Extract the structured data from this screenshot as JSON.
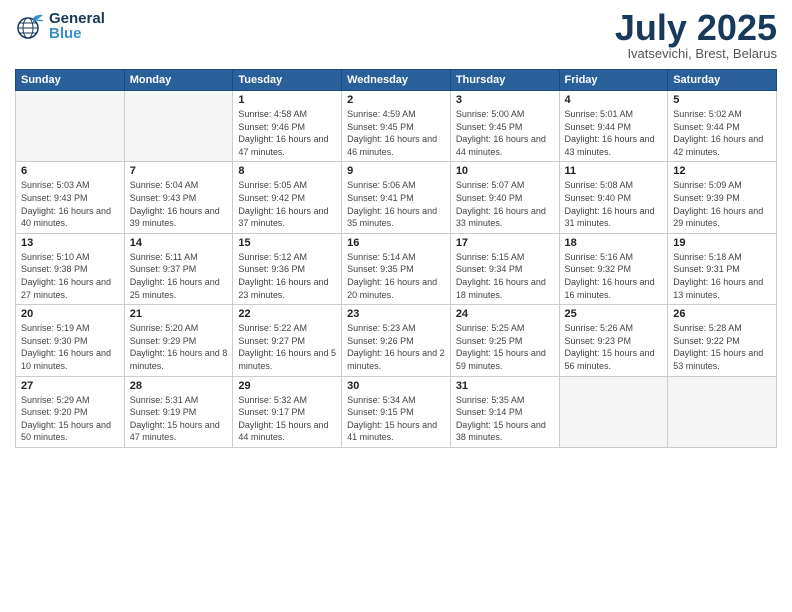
{
  "header": {
    "logo_general": "General",
    "logo_blue": "Blue",
    "month_title": "July 2025",
    "subtitle": "Ivatsevichi, Brest, Belarus"
  },
  "calendar": {
    "days_of_week": [
      "Sunday",
      "Monday",
      "Tuesday",
      "Wednesday",
      "Thursday",
      "Friday",
      "Saturday"
    ],
    "weeks": [
      [
        {
          "day": "",
          "sunrise": "",
          "sunset": "",
          "daylight": "",
          "empty": true
        },
        {
          "day": "",
          "sunrise": "",
          "sunset": "",
          "daylight": "",
          "empty": true
        },
        {
          "day": "1",
          "sunrise": "Sunrise: 4:58 AM",
          "sunset": "Sunset: 9:46 PM",
          "daylight": "Daylight: 16 hours and 47 minutes.",
          "empty": false
        },
        {
          "day": "2",
          "sunrise": "Sunrise: 4:59 AM",
          "sunset": "Sunset: 9:45 PM",
          "daylight": "Daylight: 16 hours and 46 minutes.",
          "empty": false
        },
        {
          "day": "3",
          "sunrise": "Sunrise: 5:00 AM",
          "sunset": "Sunset: 9:45 PM",
          "daylight": "Daylight: 16 hours and 44 minutes.",
          "empty": false
        },
        {
          "day": "4",
          "sunrise": "Sunrise: 5:01 AM",
          "sunset": "Sunset: 9:44 PM",
          "daylight": "Daylight: 16 hours and 43 minutes.",
          "empty": false
        },
        {
          "day": "5",
          "sunrise": "Sunrise: 5:02 AM",
          "sunset": "Sunset: 9:44 PM",
          "daylight": "Daylight: 16 hours and 42 minutes.",
          "empty": false
        }
      ],
      [
        {
          "day": "6",
          "sunrise": "Sunrise: 5:03 AM",
          "sunset": "Sunset: 9:43 PM",
          "daylight": "Daylight: 16 hours and 40 minutes.",
          "empty": false
        },
        {
          "day": "7",
          "sunrise": "Sunrise: 5:04 AM",
          "sunset": "Sunset: 9:43 PM",
          "daylight": "Daylight: 16 hours and 39 minutes.",
          "empty": false
        },
        {
          "day": "8",
          "sunrise": "Sunrise: 5:05 AM",
          "sunset": "Sunset: 9:42 PM",
          "daylight": "Daylight: 16 hours and 37 minutes.",
          "empty": false
        },
        {
          "day": "9",
          "sunrise": "Sunrise: 5:06 AM",
          "sunset": "Sunset: 9:41 PM",
          "daylight": "Daylight: 16 hours and 35 minutes.",
          "empty": false
        },
        {
          "day": "10",
          "sunrise": "Sunrise: 5:07 AM",
          "sunset": "Sunset: 9:40 PM",
          "daylight": "Daylight: 16 hours and 33 minutes.",
          "empty": false
        },
        {
          "day": "11",
          "sunrise": "Sunrise: 5:08 AM",
          "sunset": "Sunset: 9:40 PM",
          "daylight": "Daylight: 16 hours and 31 minutes.",
          "empty": false
        },
        {
          "day": "12",
          "sunrise": "Sunrise: 5:09 AM",
          "sunset": "Sunset: 9:39 PM",
          "daylight": "Daylight: 16 hours and 29 minutes.",
          "empty": false
        }
      ],
      [
        {
          "day": "13",
          "sunrise": "Sunrise: 5:10 AM",
          "sunset": "Sunset: 9:38 PM",
          "daylight": "Daylight: 16 hours and 27 minutes.",
          "empty": false
        },
        {
          "day": "14",
          "sunrise": "Sunrise: 5:11 AM",
          "sunset": "Sunset: 9:37 PM",
          "daylight": "Daylight: 16 hours and 25 minutes.",
          "empty": false
        },
        {
          "day": "15",
          "sunrise": "Sunrise: 5:12 AM",
          "sunset": "Sunset: 9:36 PM",
          "daylight": "Daylight: 16 hours and 23 minutes.",
          "empty": false
        },
        {
          "day": "16",
          "sunrise": "Sunrise: 5:14 AM",
          "sunset": "Sunset: 9:35 PM",
          "daylight": "Daylight: 16 hours and 20 minutes.",
          "empty": false
        },
        {
          "day": "17",
          "sunrise": "Sunrise: 5:15 AM",
          "sunset": "Sunset: 9:34 PM",
          "daylight": "Daylight: 16 hours and 18 minutes.",
          "empty": false
        },
        {
          "day": "18",
          "sunrise": "Sunrise: 5:16 AM",
          "sunset": "Sunset: 9:32 PM",
          "daylight": "Daylight: 16 hours and 16 minutes.",
          "empty": false
        },
        {
          "day": "19",
          "sunrise": "Sunrise: 5:18 AM",
          "sunset": "Sunset: 9:31 PM",
          "daylight": "Daylight: 16 hours and 13 minutes.",
          "empty": false
        }
      ],
      [
        {
          "day": "20",
          "sunrise": "Sunrise: 5:19 AM",
          "sunset": "Sunset: 9:30 PM",
          "daylight": "Daylight: 16 hours and 10 minutes.",
          "empty": false
        },
        {
          "day": "21",
          "sunrise": "Sunrise: 5:20 AM",
          "sunset": "Sunset: 9:29 PM",
          "daylight": "Daylight: 16 hours and 8 minutes.",
          "empty": false
        },
        {
          "day": "22",
          "sunrise": "Sunrise: 5:22 AM",
          "sunset": "Sunset: 9:27 PM",
          "daylight": "Daylight: 16 hours and 5 minutes.",
          "empty": false
        },
        {
          "day": "23",
          "sunrise": "Sunrise: 5:23 AM",
          "sunset": "Sunset: 9:26 PM",
          "daylight": "Daylight: 16 hours and 2 minutes.",
          "empty": false
        },
        {
          "day": "24",
          "sunrise": "Sunrise: 5:25 AM",
          "sunset": "Sunset: 9:25 PM",
          "daylight": "Daylight: 15 hours and 59 minutes.",
          "empty": false
        },
        {
          "day": "25",
          "sunrise": "Sunrise: 5:26 AM",
          "sunset": "Sunset: 9:23 PM",
          "daylight": "Daylight: 15 hours and 56 minutes.",
          "empty": false
        },
        {
          "day": "26",
          "sunrise": "Sunrise: 5:28 AM",
          "sunset": "Sunset: 9:22 PM",
          "daylight": "Daylight: 15 hours and 53 minutes.",
          "empty": false
        }
      ],
      [
        {
          "day": "27",
          "sunrise": "Sunrise: 5:29 AM",
          "sunset": "Sunset: 9:20 PM",
          "daylight": "Daylight: 15 hours and 50 minutes.",
          "empty": false
        },
        {
          "day": "28",
          "sunrise": "Sunrise: 5:31 AM",
          "sunset": "Sunset: 9:19 PM",
          "daylight": "Daylight: 15 hours and 47 minutes.",
          "empty": false
        },
        {
          "day": "29",
          "sunrise": "Sunrise: 5:32 AM",
          "sunset": "Sunset: 9:17 PM",
          "daylight": "Daylight: 15 hours and 44 minutes.",
          "empty": false
        },
        {
          "day": "30",
          "sunrise": "Sunrise: 5:34 AM",
          "sunset": "Sunset: 9:15 PM",
          "daylight": "Daylight: 15 hours and 41 minutes.",
          "empty": false
        },
        {
          "day": "31",
          "sunrise": "Sunrise: 5:35 AM",
          "sunset": "Sunset: 9:14 PM",
          "daylight": "Daylight: 15 hours and 38 minutes.",
          "empty": false
        },
        {
          "day": "",
          "sunrise": "",
          "sunset": "",
          "daylight": "",
          "empty": true
        },
        {
          "day": "",
          "sunrise": "",
          "sunset": "",
          "daylight": "",
          "empty": true
        }
      ]
    ]
  }
}
